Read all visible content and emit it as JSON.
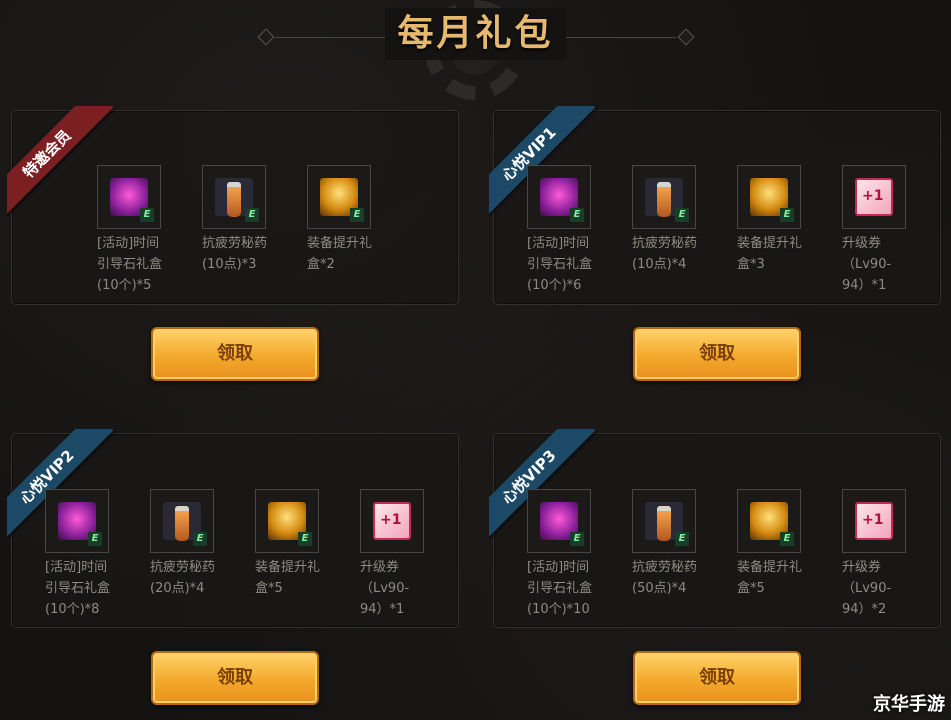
{
  "title": "每月礼包",
  "claim_label": "领取",
  "watermark": "京华手游",
  "panels": [
    {
      "ribbon": "特邀会员",
      "ribbon_color": "#7b1f22",
      "items": [
        {
          "icon": "gift-box-icon",
          "name": "[活动]时间\n引导石礼盒\n(10个)*5"
        },
        {
          "icon": "potion-icon",
          "name": "抗疲劳秘药\n(10点)*3"
        },
        {
          "icon": "treasure-chest-icon",
          "name": "装备提升礼\n盒*2"
        }
      ]
    },
    {
      "ribbon": "心悦VIP1",
      "ribbon_color": "#1c4a66",
      "items": [
        {
          "icon": "gift-box-icon",
          "name": "[活动]时间\n引导石礼盒\n(10个)*6"
        },
        {
          "icon": "potion-icon",
          "name": "抗疲劳秘药\n(10点)*4"
        },
        {
          "icon": "treasure-chest-icon",
          "name": "装备提升礼\n盒*3"
        },
        {
          "icon": "level-ticket-icon",
          "name": "升级券\n（Lv90-\n94）*1"
        }
      ]
    },
    {
      "ribbon": "心悦VIP2",
      "ribbon_color": "#1c4a66",
      "items": [
        {
          "icon": "gift-box-icon",
          "name": "[活动]时间\n引导石礼盒\n(10个)*8"
        },
        {
          "icon": "potion-icon",
          "name": "抗疲劳秘药\n(20点)*4"
        },
        {
          "icon": "treasure-chest-icon",
          "name": "装备提升礼\n盒*5"
        },
        {
          "icon": "level-ticket-icon",
          "name": "升级券\n（Lv90-\n94）*1"
        }
      ]
    },
    {
      "ribbon": "心悦VIP3",
      "ribbon_color": "#1c4a66",
      "items": [
        {
          "icon": "gift-box-icon",
          "name": "[活动]时间\n引导石礼盒\n(10个)*10"
        },
        {
          "icon": "potion-icon",
          "name": "抗疲劳秘药\n(50点)*4"
        },
        {
          "icon": "treasure-chest-icon",
          "name": "装备提升礼\n盒*5"
        },
        {
          "icon": "level-ticket-icon",
          "name": "升级券\n（Lv90-\n94）*2"
        }
      ]
    }
  ]
}
